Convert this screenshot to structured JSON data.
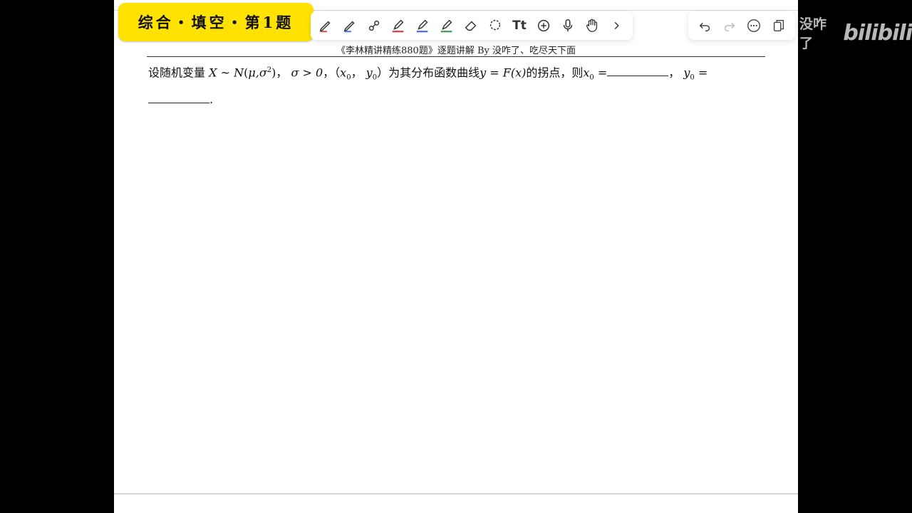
{
  "title_badge": "综合・填空・第1题",
  "doc_header": "《李林精讲精练880题》逐题讲解 By 没咋了、吃尽天下面",
  "problem": {
    "prefix": "设随机变量",
    "dist_X": "X",
    "dist_tilde": "~",
    "dist_N": "N",
    "dist_args": "μ,σ",
    "dist_sup": "2",
    "cond": "σ > 0",
    "point_x": "x",
    "point_y": "y",
    "sub0": "0",
    "mid": "为其分布函数曲线",
    "curve": "y = F(x)",
    "suffix": "的拐点，则",
    "x0_label": "x",
    "y0_label": "y",
    "eq": "=",
    "period": "."
  },
  "watermark": {
    "user": "没咋了",
    "logo": "bilibili"
  },
  "toolbar": {
    "tools": [
      "pen-icon",
      "pen-icon",
      "link-pen-icon",
      "highlighter-red-icon",
      "highlighter-blue-icon",
      "highlighter-green-icon",
      "eraser-icon",
      "lasso-icon",
      "text-icon",
      "add-icon",
      "microphone-icon",
      "hand-icon",
      "chevron-right-icon"
    ],
    "text_tool_label": "Tt"
  },
  "right_toolbar": {
    "tools": [
      "undo-icon",
      "redo-icon",
      "more-icon",
      "pages-icon"
    ]
  },
  "colors": {
    "badge": "#ffe200",
    "highlighter_red": "#d93b3b",
    "highlighter_blue": "#3a6fd8",
    "highlighter_green": "#3a9a4a"
  }
}
